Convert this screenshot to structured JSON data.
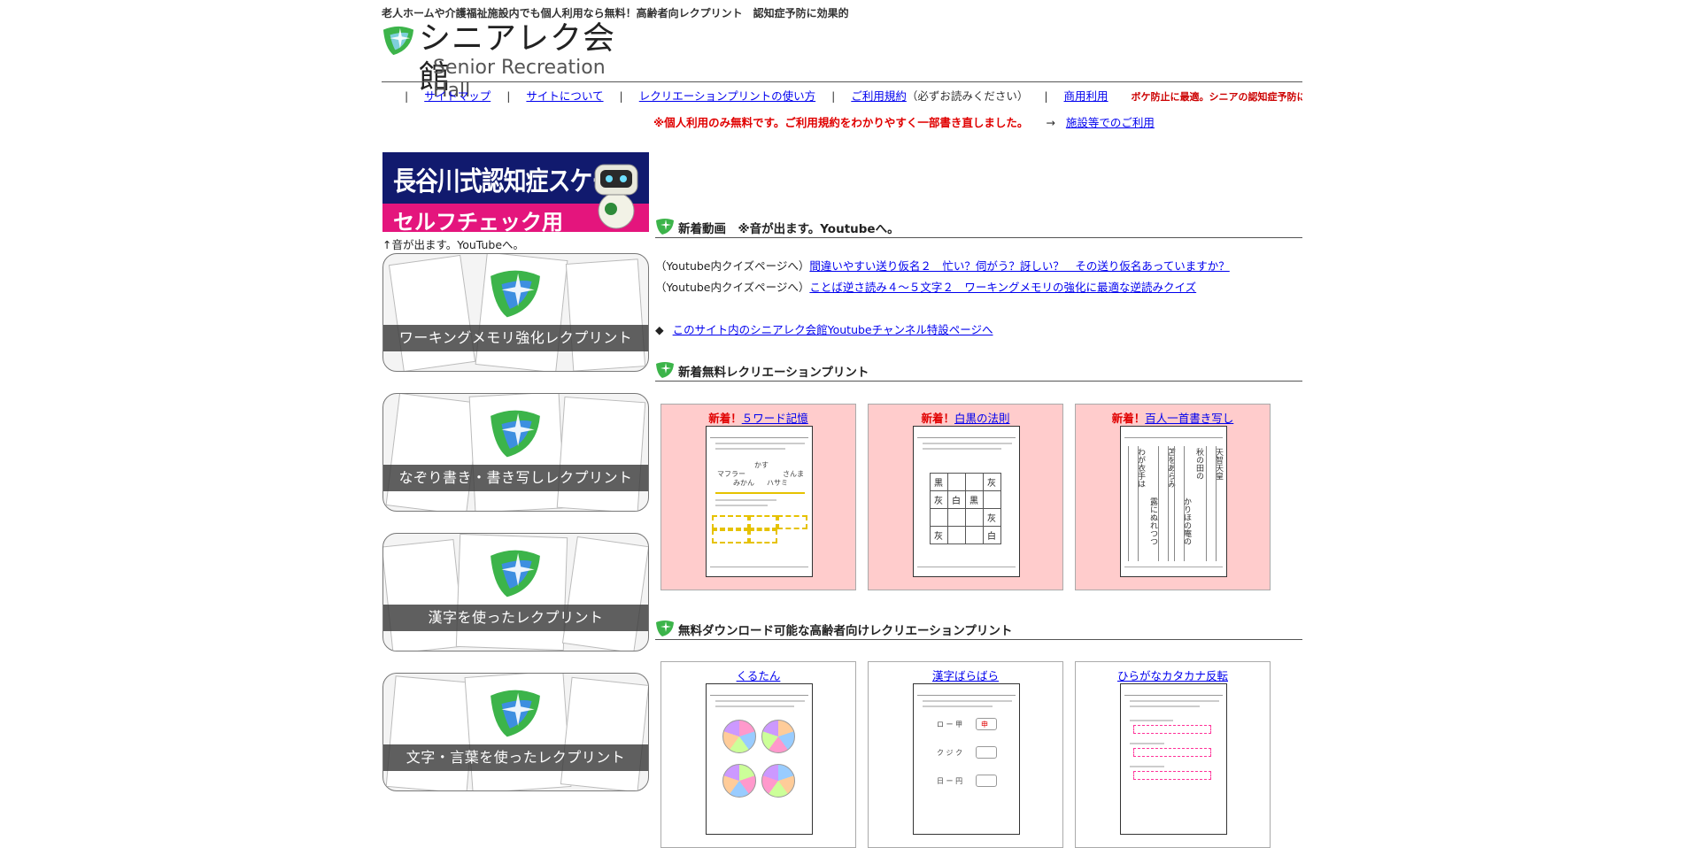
{
  "header": {
    "tagline": "老人ホームや介護福祉施設内でも個人利用なら無料！高齢者向レクプリント　認知症予防に効果的",
    "logo_jp": "シニアレク会館",
    "logo_en": "Senior Recreation Hall"
  },
  "nav": {
    "items": [
      {
        "label": "サイトマップ"
      },
      {
        "label": "サイトについて"
      },
      {
        "label": "レクリエーションプリントの使い方"
      },
      {
        "label": "ご利用規約",
        "note": "（必ずお読みください）"
      },
      {
        "label": "商用利用"
      }
    ],
    "warning": "ボケ防止に最適。シニアの認知症予防にレクリプリントを"
  },
  "notice": {
    "text": "※個人利用のみ無料です。ご利用規約をわかりやすく一部書き直しました。",
    "arrow": "→",
    "link": "施設等でのご利用"
  },
  "banner": {
    "line1": "長谷川式認知症スケール",
    "line2": "セルフチェック用",
    "caption": "↑音が出ます。YouTubeへ。"
  },
  "categories": [
    {
      "label": "ワーキングメモリ強化レクプリント"
    },
    {
      "label": "なぞり書き・書き写しレクプリント"
    },
    {
      "label": "漢字を使ったレクプリント"
    },
    {
      "label": "文字・言葉を使ったレクプリント"
    }
  ],
  "videos": {
    "title": "新着動画　※音が出ます。Youtubeへ。",
    "items": [
      {
        "prefix": "（Youtube内クイズページへ）",
        "link": "間違いやすい送り仮名２　忙い？伺がう？訝しい？　その送り仮名あっていますか？"
      },
      {
        "prefix": "（Youtube内クイズページへ）",
        "link": "ことば逆さ読み４～５文字２　ワーキングメモリの強化に最適な逆読みクイズ"
      }
    ],
    "channel_bullet": "◆",
    "channel_link": "このサイト内のシニアレク会館Youtubeチャンネル特設ページへ"
  },
  "new_prints": {
    "title": "新着無料レクリエーションプリント",
    "new_label": "新着！",
    "cards": [
      {
        "title": "５ワード記憶"
      },
      {
        "title": "白黒の法則"
      },
      {
        "title": "百人一首書き写し"
      }
    ],
    "grid_cells": [
      "黒",
      "",
      "",
      "灰",
      "灰",
      "白",
      "黒",
      "",
      "",
      "",
      "",
      "灰",
      "灰",
      "",
      "",
      "白"
    ],
    "poem_cols": [
      "天智天皇",
      "秋の田の",
      "かりほの庵の",
      "苫をあらみ",
      "わが衣手は",
      "露にぬれつつ"
    ],
    "word_sample": [
      "かす",
      "マフラー",
      "さんま",
      "みかん",
      "ハサミ"
    ]
  },
  "downloads": {
    "title": "無料ダウンロード可能な高齢者向けレクリエーションプリント",
    "cards": [
      {
        "title": "くるたん"
      },
      {
        "title": "漢字ばらばら"
      },
      {
        "title": "ひらがなカタカナ反転"
      }
    ],
    "kanji_rows": [
      "ロ ー 甲",
      "ク ジ ク",
      "日 ー 円"
    ],
    "kanji_answer": "申"
  },
  "colors": {
    "accent_green": "#3cb44a",
    "link_blue": "#0000ee",
    "warn_red": "#e00000",
    "card_pink": "#ffcccc",
    "banner_navy": "#111a6e",
    "banner_magenta": "#e4157d"
  }
}
